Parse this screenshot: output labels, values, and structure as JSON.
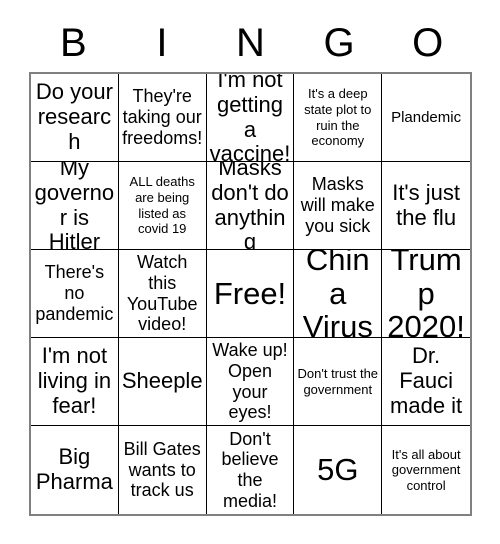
{
  "header": {
    "letters": [
      "B",
      "I",
      "N",
      "G",
      "O"
    ]
  },
  "grid": {
    "rows": 5,
    "columns": 5,
    "border_color": "#808080",
    "line_color": "#000000",
    "background_color": "#ffffff",
    "text_color": "#000000",
    "cells": [
      {
        "text": "Do your research",
        "size": "lg"
      },
      {
        "text": "They're taking our freedoms!",
        "size": "md"
      },
      {
        "text": "I'm not getting a vaccine!",
        "size": "lg"
      },
      {
        "text": "It's a deep state plot to ruin the economy",
        "size": "xs"
      },
      {
        "text": "Plandemic",
        "size": "sm"
      },
      {
        "text": "My governor is Hitler",
        "size": "lg"
      },
      {
        "text": "ALL deaths are being listed as covid 19",
        "size": "xs"
      },
      {
        "text": "Masks don't do anything",
        "size": "lg"
      },
      {
        "text": "Masks will make you sick",
        "size": "md"
      },
      {
        "text": "It's just the flu",
        "size": "lg"
      },
      {
        "text": "There's no pandemic",
        "size": "md"
      },
      {
        "text": "Watch this YouTube video!",
        "size": "md"
      },
      {
        "text": "Free!",
        "size": "xl"
      },
      {
        "text": "China Virus",
        "size": "xl"
      },
      {
        "text": "Trump 2020!",
        "size": "xl"
      },
      {
        "text": "I'm not living in fear!",
        "size": "lg"
      },
      {
        "text": "Sheeple",
        "size": "lg"
      },
      {
        "text": "Wake up! Open your eyes!",
        "size": "md"
      },
      {
        "text": "Don't trust the government",
        "size": "xs"
      },
      {
        "text": "Dr. Fauci made it",
        "size": "lg"
      },
      {
        "text": "Big Pharma",
        "size": "lg"
      },
      {
        "text": "Bill Gates wants to track us",
        "size": "md"
      },
      {
        "text": "Don't believe the media!",
        "size": "md"
      },
      {
        "text": "5G",
        "size": "xl"
      },
      {
        "text": "It's all about government control",
        "size": "xs"
      }
    ]
  }
}
